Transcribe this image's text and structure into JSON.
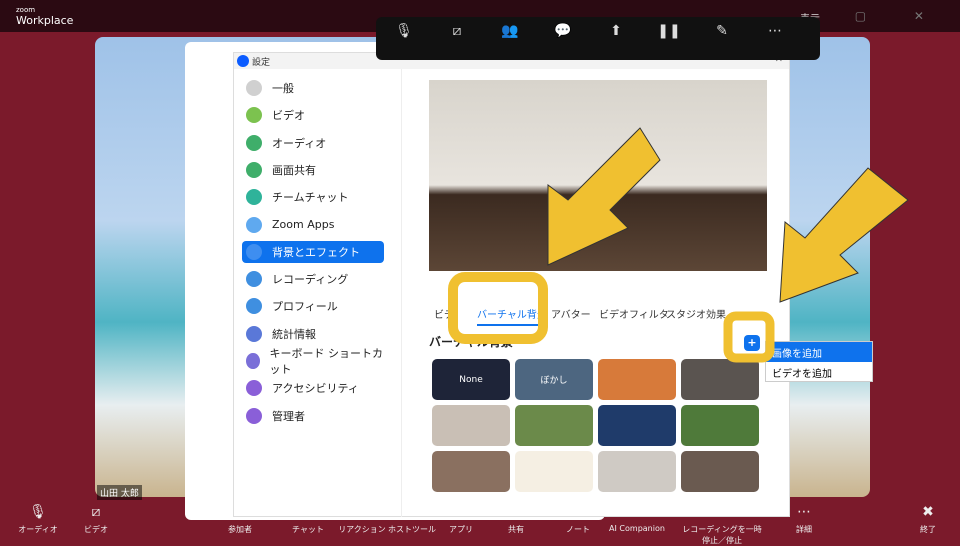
{
  "app": {
    "logo_small": "zoom",
    "logo_large": "Workplace",
    "view_label": "表示",
    "window_controls": "– ▢ ✕"
  },
  "video": {
    "participant_name": "山田 太郎"
  },
  "settings": {
    "title": "設定",
    "close": "✕",
    "sidebar": [
      {
        "label": "一般",
        "color": "#d0d0d0"
      },
      {
        "label": "ビデオ",
        "color": "#7cc24f"
      },
      {
        "label": "オーディオ",
        "color": "#3fae6a"
      },
      {
        "label": "画面共有",
        "color": "#3fae6a"
      },
      {
        "label": "チームチャット",
        "color": "#2fb39a"
      },
      {
        "label": "Zoom Apps",
        "color": "#5fa9ef"
      },
      {
        "label": "背景とエフェクト",
        "color": "#ffffff",
        "active": true
      },
      {
        "label": "レコーディング",
        "color": "#3f8fe0"
      },
      {
        "label": "プロフィール",
        "color": "#3f8fe0"
      },
      {
        "label": "統計情報",
        "color": "#5a78d8"
      },
      {
        "label": "キーボード ショートカット",
        "color": "#7a6fd8"
      },
      {
        "label": "アクセシビリティ",
        "color": "#8a5fd8"
      },
      {
        "label": "管理者",
        "color": "#8a5fd8"
      }
    ],
    "tabs": [
      "ビデ",
      "バーチャル背景",
      "アバター",
      "ビデオフィルタ",
      "スタジオ効果"
    ],
    "active_tab": "バーチャル背景",
    "section_title": "バーチャル背景",
    "add_button": "+",
    "add_menu": [
      "画像を追加",
      "ビデオを追加"
    ],
    "thumbnails": [
      {
        "label": "None",
        "color": "#1e2438"
      },
      {
        "label": "ぼかし",
        "color": "#4d6680"
      },
      {
        "label": "",
        "color": "#d77a3a"
      },
      {
        "label": "",
        "color": "#5a5450"
      },
      {
        "label": "",
        "color": "#c9bfb5"
      },
      {
        "label": "",
        "color": "#6b8a4a"
      },
      {
        "label": "",
        "color": "#1f3b6a"
      },
      {
        "label": "",
        "color": "#4f7a3a"
      },
      {
        "label": "",
        "color": "#8a7060"
      },
      {
        "label": "",
        "color": "#f5efe3"
      },
      {
        "label": "",
        "color": "#cfcac4"
      },
      {
        "label": "",
        "color": "#6a5a50"
      }
    ]
  },
  "toolbar": [
    {
      "icon": "microphone-icon",
      "glyph": "🎙"
    },
    {
      "icon": "video-off-icon",
      "glyph": "⧄"
    },
    {
      "icon": "participants-icon",
      "glyph": "👥"
    },
    {
      "icon": "chat-icon",
      "glyph": "💬"
    },
    {
      "icon": "share-icon",
      "glyph": "⬆"
    },
    {
      "icon": "pause-icon",
      "glyph": "❚❚"
    },
    {
      "icon": "annotate-icon",
      "glyph": "✎"
    },
    {
      "icon": "more-icon",
      "glyph": "⋯"
    }
  ],
  "bottom_bar": [
    {
      "label": "オーディオ",
      "glyph": "🎙"
    },
    {
      "label": "ビデオ",
      "glyph": "⧄"
    },
    {
      "label": "参加者",
      "glyph": ""
    },
    {
      "label": "チャット",
      "glyph": ""
    },
    {
      "label": "リアクション",
      "glyph": ""
    },
    {
      "label": "ホストツール",
      "glyph": ""
    },
    {
      "label": "アプリ",
      "glyph": ""
    },
    {
      "label": "共有",
      "glyph": ""
    },
    {
      "label": "ノート",
      "glyph": ""
    },
    {
      "label": "AI Companion",
      "glyph": ""
    },
    {
      "label": "レコーディングを一時停止／停止",
      "glyph": ""
    },
    {
      "label": "詳細",
      "glyph": "⋯"
    },
    {
      "label": "終了",
      "glyph": "✖"
    }
  ],
  "annotation_color": "#f0c030"
}
